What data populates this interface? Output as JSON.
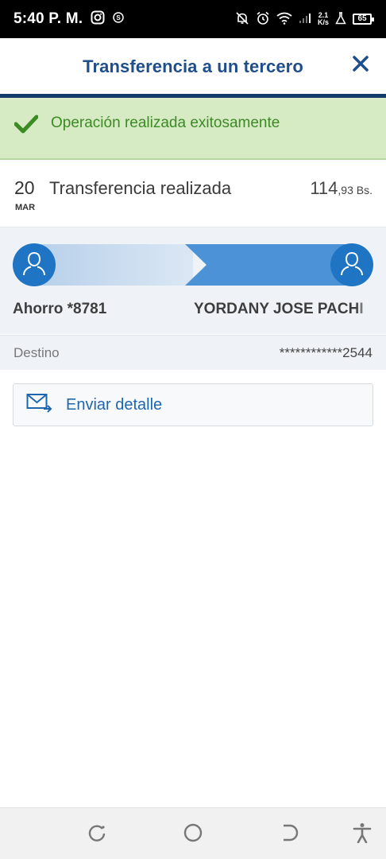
{
  "status_bar": {
    "time": "5:40 P. M.",
    "net_speed_value": "2.1",
    "net_speed_unit": "K/s",
    "battery": "65"
  },
  "header": {
    "title": "Transferencia a un tercero",
    "close_icon": "close-icon"
  },
  "banner": {
    "message": "Operación realizada exitosamente",
    "icon": "checkmark-icon",
    "color": "#3b8a24"
  },
  "transaction": {
    "day": "20",
    "month": "MAR",
    "description": "Transferencia realizada",
    "amount_integer": "114",
    "amount_decimal": ",93 Bs."
  },
  "transfer": {
    "from_account": "Ahorro *8781",
    "to_name": "YORDANY JOSE PACHI"
  },
  "destination": {
    "label": "Destino",
    "value": "************2544"
  },
  "actions": {
    "send_detail": "Enviar detalle"
  },
  "colors": {
    "primary": "#1f4e8c",
    "accent_blue": "#1f74c4",
    "success_bg": "#d6ebc4"
  }
}
